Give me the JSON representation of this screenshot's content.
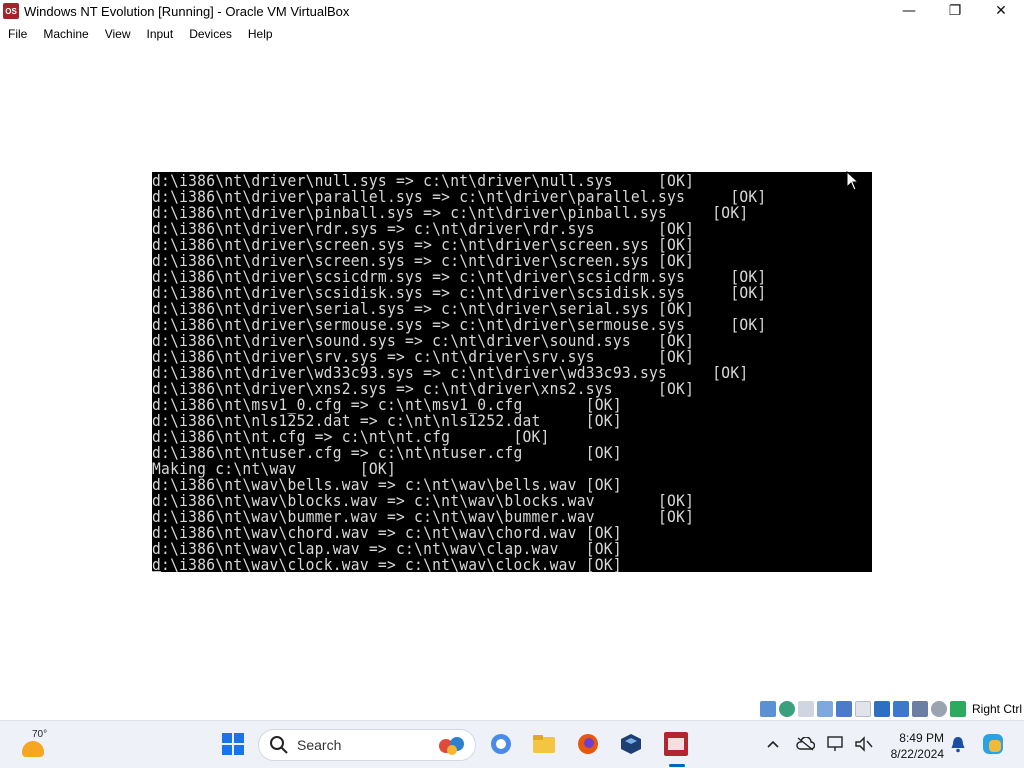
{
  "window": {
    "title": "Windows NT Evolution [Running] - Oracle VM VirtualBox",
    "app_icon_text": "OS",
    "minimize_glyph": "—",
    "maximize_glyph": "❐",
    "close_glyph": "✕"
  },
  "menubar": {
    "items": [
      "File",
      "Machine",
      "View",
      "Input",
      "Devices",
      "Help"
    ]
  },
  "console": {
    "lines": [
      "d:\\i386\\nt\\driver\\null.sys => c:\\nt\\driver\\null.sys     [OK]",
      "d:\\i386\\nt\\driver\\parallel.sys => c:\\nt\\driver\\parallel.sys     [OK]",
      "d:\\i386\\nt\\driver\\pinball.sys => c:\\nt\\driver\\pinball.sys     [OK]",
      "d:\\i386\\nt\\driver\\rdr.sys => c:\\nt\\driver\\rdr.sys       [OK]",
      "d:\\i386\\nt\\driver\\screen.sys => c:\\nt\\driver\\screen.sys [OK]",
      "d:\\i386\\nt\\driver\\screen.sys => c:\\nt\\driver\\screen.sys [OK]",
      "d:\\i386\\nt\\driver\\scsicdrm.sys => c:\\nt\\driver\\scsicdrm.sys     [OK]",
      "d:\\i386\\nt\\driver\\scsidisk.sys => c:\\nt\\driver\\scsidisk.sys     [OK]",
      "d:\\i386\\nt\\driver\\serial.sys => c:\\nt\\driver\\serial.sys [OK]",
      "d:\\i386\\nt\\driver\\sermouse.sys => c:\\nt\\driver\\sermouse.sys     [OK]",
      "d:\\i386\\nt\\driver\\sound.sys => c:\\nt\\driver\\sound.sys   [OK]",
      "d:\\i386\\nt\\driver\\srv.sys => c:\\nt\\driver\\srv.sys       [OK]",
      "d:\\i386\\nt\\driver\\wd33c93.sys => c:\\nt\\driver\\wd33c93.sys     [OK]",
      "d:\\i386\\nt\\driver\\xns2.sys => c:\\nt\\driver\\xns2.sys     [OK]",
      "d:\\i386\\nt\\msv1_0.cfg => c:\\nt\\msv1_0.cfg       [OK]",
      "d:\\i386\\nt\\nls1252.dat => c:\\nt\\nls1252.dat     [OK]",
      "d:\\i386\\nt\\nt.cfg => c:\\nt\\nt.cfg       [OK]",
      "d:\\i386\\nt\\ntuser.cfg => c:\\nt\\ntuser.cfg       [OK]",
      "Making c:\\nt\\wav       [OK]",
      "d:\\i386\\nt\\wav\\bells.wav => c:\\nt\\wav\\bells.wav [OK]",
      "d:\\i386\\nt\\wav\\blocks.wav => c:\\nt\\wav\\blocks.wav       [OK]",
      "d:\\i386\\nt\\wav\\bummer.wav => c:\\nt\\wav\\bummer.wav       [OK]",
      "d:\\i386\\nt\\wav\\chord.wav => c:\\nt\\wav\\chord.wav [OK]",
      "d:\\i386\\nt\\wav\\clap.wav => c:\\nt\\wav\\clap.wav   [OK]",
      "d:\\i386\\nt\\wav\\clock.wav => c:\\nt\\wav\\clock.wav [OK]"
    ]
  },
  "statusbar": {
    "icons": [
      "optical-drive-icon",
      "network-icon",
      "usb-icon",
      "shared-folders-icon",
      "display-icon",
      "video-capture-icon",
      "recording-icon",
      "mouse-integration-icon",
      "cpu-icon",
      "keyboard-icon",
      "settings-icon",
      "arrow-icon"
    ],
    "host_key_label": "Right Ctrl"
  },
  "taskbar": {
    "weather_temp": "70°",
    "search_placeholder": "Search",
    "clock_time": "8:49 PM",
    "clock_date": "8/22/2024",
    "colors": {
      "accent": "#0067c0",
      "windows_blue": "#1a73e8"
    }
  }
}
